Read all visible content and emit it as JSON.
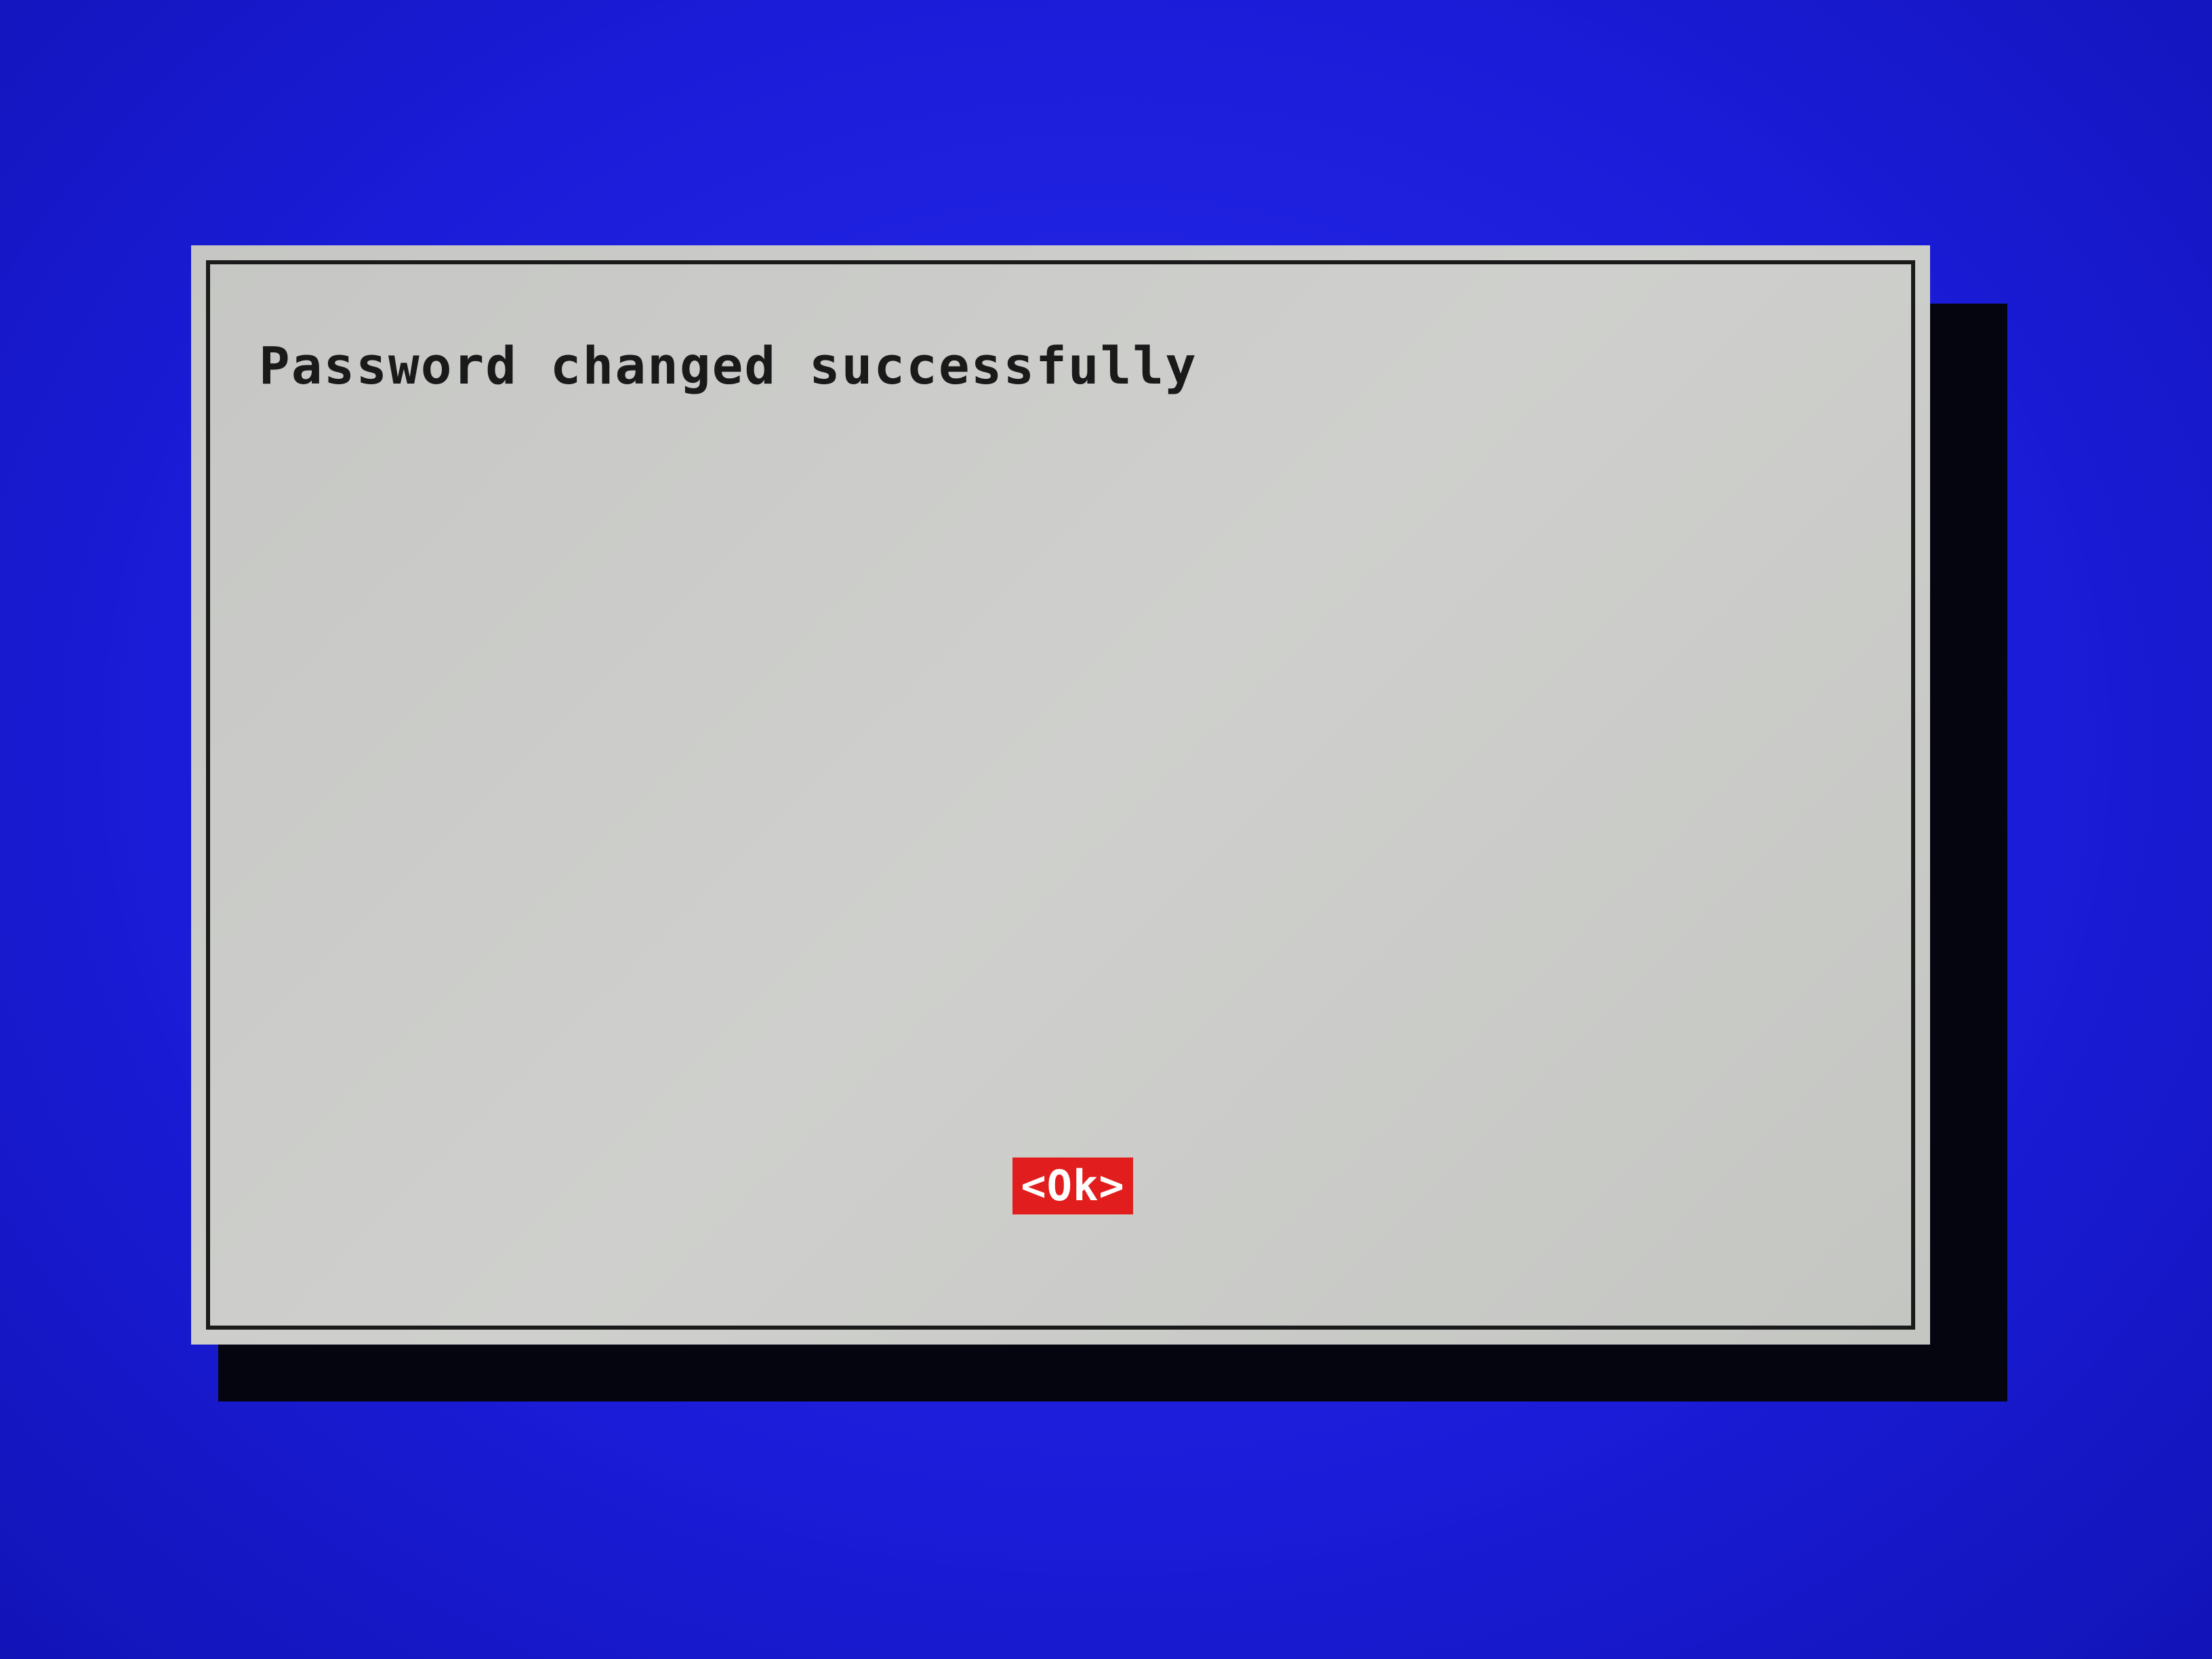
{
  "screen": {
    "background_color": "#1c1ee0"
  },
  "dialog": {
    "background_color": "#c9cac8",
    "border_color": "#1b1b1b",
    "shadow_color": "#050510",
    "message": "Password changed successfully",
    "ok_button": {
      "label": "<Ok>",
      "background_color": "#e21d1d",
      "text_color": "#ffffff",
      "focused": true
    }
  }
}
